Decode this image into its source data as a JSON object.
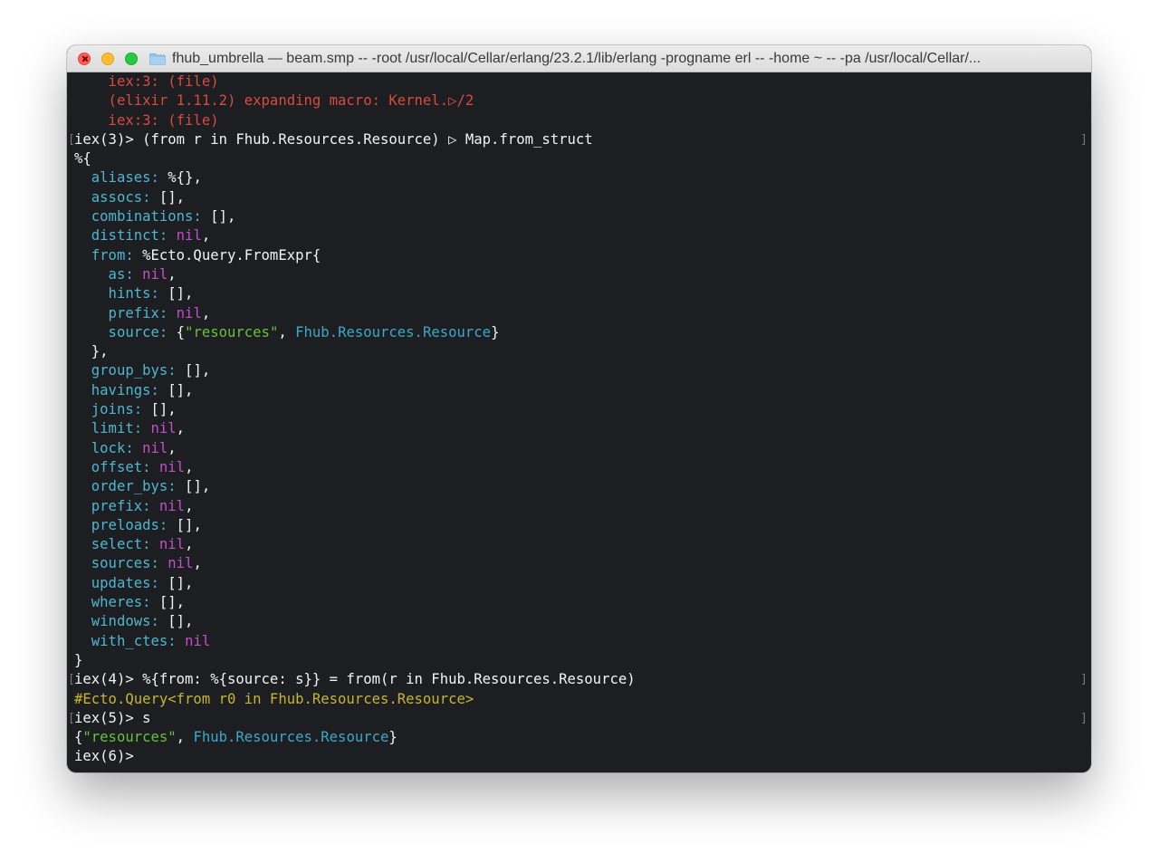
{
  "window": {
    "title": "fhub_umbrella — beam.smp -- -root /usr/local/Cellar/erlang/23.2.1/lib/erlang -progname erl -- -home ~ -- -pa /usr/local/Cellar/..."
  },
  "colors": {
    "background": "#1c1e21",
    "error": "#d84b3d",
    "atom_key": "#4fb6cf",
    "nil": "#c150c6",
    "string": "#66c23b",
    "module": "#3ca9c9",
    "inspect": "#c7b434"
  },
  "terminal": {
    "lines": [
      {
        "segments": [
          {
            "t": "    iex:3: (file)",
            "c": "err"
          }
        ]
      },
      {
        "segments": [
          {
            "t": "    (elixir 1.11.2) expanding macro: Kernel.▷/2",
            "c": "err"
          }
        ]
      },
      {
        "segments": [
          {
            "t": "    iex:3: (file)",
            "c": "err"
          }
        ]
      },
      {
        "marks": true,
        "segments": [
          {
            "t": "iex(3)> (from r in Fhub.Resources.Resource) ▷ Map.from_struct",
            "c": "fg"
          }
        ]
      },
      {
        "segments": [
          {
            "t": "%{",
            "c": "fg"
          }
        ]
      },
      {
        "segments": [
          {
            "t": "  aliases:",
            "c": "key"
          },
          {
            "t": " %{},",
            "c": "fg"
          }
        ]
      },
      {
        "segments": [
          {
            "t": "  assocs:",
            "c": "key"
          },
          {
            "t": " [],",
            "c": "fg"
          }
        ]
      },
      {
        "segments": [
          {
            "t": "  combinations:",
            "c": "key"
          },
          {
            "t": " [],",
            "c": "fg"
          }
        ]
      },
      {
        "segments": [
          {
            "t": "  distinct:",
            "c": "key"
          },
          {
            "t": " ",
            "c": "fg"
          },
          {
            "t": "nil",
            "c": "nil"
          },
          {
            "t": ",",
            "c": "fg"
          }
        ]
      },
      {
        "segments": [
          {
            "t": "  from:",
            "c": "key"
          },
          {
            "t": " %Ecto.Query.FromExpr{",
            "c": "fg"
          }
        ]
      },
      {
        "segments": [
          {
            "t": "    as:",
            "c": "key"
          },
          {
            "t": " ",
            "c": "fg"
          },
          {
            "t": "nil",
            "c": "nil"
          },
          {
            "t": ",",
            "c": "fg"
          }
        ]
      },
      {
        "segments": [
          {
            "t": "    hints:",
            "c": "key"
          },
          {
            "t": " [],",
            "c": "fg"
          }
        ]
      },
      {
        "segments": [
          {
            "t": "    prefix:",
            "c": "key"
          },
          {
            "t": " ",
            "c": "fg"
          },
          {
            "t": "nil",
            "c": "nil"
          },
          {
            "t": ",",
            "c": "fg"
          }
        ]
      },
      {
        "segments": [
          {
            "t": "    source:",
            "c": "key"
          },
          {
            "t": " {",
            "c": "fg"
          },
          {
            "t": "\"resources\"",
            "c": "str"
          },
          {
            "t": ", ",
            "c": "fg"
          },
          {
            "t": "Fhub.Resources.Resource",
            "c": "mod"
          },
          {
            "t": "}",
            "c": "fg"
          }
        ]
      },
      {
        "segments": [
          {
            "t": "  },",
            "c": "fg"
          }
        ]
      },
      {
        "segments": [
          {
            "t": "  group_bys:",
            "c": "key"
          },
          {
            "t": " [],",
            "c": "fg"
          }
        ]
      },
      {
        "segments": [
          {
            "t": "  havings:",
            "c": "key"
          },
          {
            "t": " [],",
            "c": "fg"
          }
        ]
      },
      {
        "segments": [
          {
            "t": "  joins:",
            "c": "key"
          },
          {
            "t": " [],",
            "c": "fg"
          }
        ]
      },
      {
        "segments": [
          {
            "t": "  limit:",
            "c": "key"
          },
          {
            "t": " ",
            "c": "fg"
          },
          {
            "t": "nil",
            "c": "nil"
          },
          {
            "t": ",",
            "c": "fg"
          }
        ]
      },
      {
        "segments": [
          {
            "t": "  lock:",
            "c": "key"
          },
          {
            "t": " ",
            "c": "fg"
          },
          {
            "t": "nil",
            "c": "nil"
          },
          {
            "t": ",",
            "c": "fg"
          }
        ]
      },
      {
        "segments": [
          {
            "t": "  offset:",
            "c": "key"
          },
          {
            "t": " ",
            "c": "fg"
          },
          {
            "t": "nil",
            "c": "nil"
          },
          {
            "t": ",",
            "c": "fg"
          }
        ]
      },
      {
        "segments": [
          {
            "t": "  order_bys:",
            "c": "key"
          },
          {
            "t": " [],",
            "c": "fg"
          }
        ]
      },
      {
        "segments": [
          {
            "t": "  prefix:",
            "c": "key"
          },
          {
            "t": " ",
            "c": "fg"
          },
          {
            "t": "nil",
            "c": "nil"
          },
          {
            "t": ",",
            "c": "fg"
          }
        ]
      },
      {
        "segments": [
          {
            "t": "  preloads:",
            "c": "key"
          },
          {
            "t": " [],",
            "c": "fg"
          }
        ]
      },
      {
        "segments": [
          {
            "t": "  select:",
            "c": "key"
          },
          {
            "t": " ",
            "c": "fg"
          },
          {
            "t": "nil",
            "c": "nil"
          },
          {
            "t": ",",
            "c": "fg"
          }
        ]
      },
      {
        "segments": [
          {
            "t": "  sources:",
            "c": "key"
          },
          {
            "t": " ",
            "c": "fg"
          },
          {
            "t": "nil",
            "c": "nil"
          },
          {
            "t": ",",
            "c": "fg"
          }
        ]
      },
      {
        "segments": [
          {
            "t": "  updates:",
            "c": "key"
          },
          {
            "t": " [],",
            "c": "fg"
          }
        ]
      },
      {
        "segments": [
          {
            "t": "  wheres:",
            "c": "key"
          },
          {
            "t": " [],",
            "c": "fg"
          }
        ]
      },
      {
        "segments": [
          {
            "t": "  windows:",
            "c": "key"
          },
          {
            "t": " [],",
            "c": "fg"
          }
        ]
      },
      {
        "segments": [
          {
            "t": "  with_ctes:",
            "c": "key"
          },
          {
            "t": " ",
            "c": "fg"
          },
          {
            "t": "nil",
            "c": "nil"
          }
        ]
      },
      {
        "segments": [
          {
            "t": "}",
            "c": "fg"
          }
        ]
      },
      {
        "marks": true,
        "segments": [
          {
            "t": "iex(4)> %{from: %{source: s}} = from(r in Fhub.Resources.Resource)",
            "c": "fg"
          }
        ]
      },
      {
        "segments": [
          {
            "t": "#Ecto.Query<from r0 in Fhub.Resources.Resource>",
            "c": "inspect"
          }
        ]
      },
      {
        "marks": true,
        "segments": [
          {
            "t": "iex(5)> s",
            "c": "fg"
          }
        ]
      },
      {
        "segments": [
          {
            "t": "{",
            "c": "fg"
          },
          {
            "t": "\"resources\"",
            "c": "str"
          },
          {
            "t": ", ",
            "c": "fg"
          },
          {
            "t": "Fhub.Resources.Resource",
            "c": "mod"
          },
          {
            "t": "}",
            "c": "fg"
          }
        ]
      },
      {
        "segments": [
          {
            "t": "iex(6)> ",
            "c": "fg"
          }
        ]
      }
    ]
  }
}
